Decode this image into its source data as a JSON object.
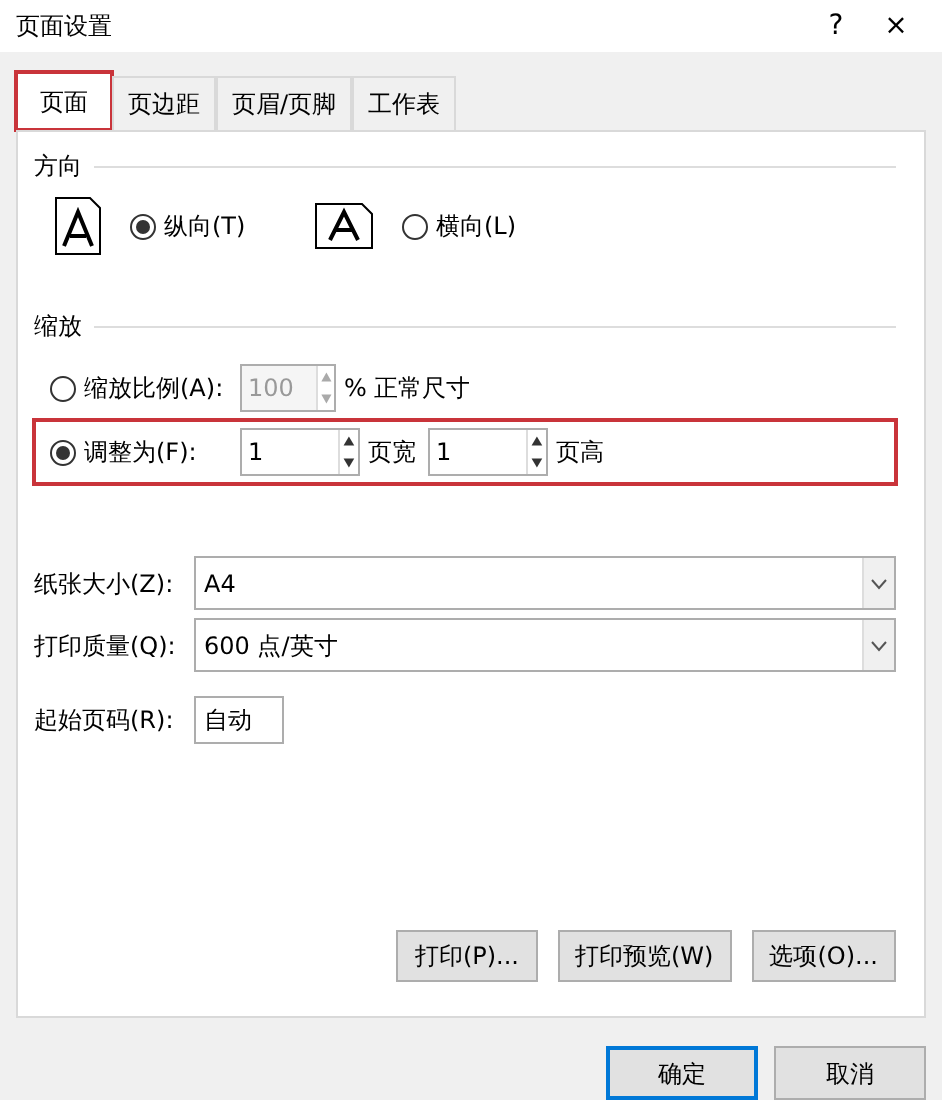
{
  "window": {
    "title": "页面设置",
    "help": "?",
    "close": "×"
  },
  "tabs": [
    {
      "label": "页面",
      "selected": true,
      "highlighted": true
    },
    {
      "label": "页边距",
      "selected": false,
      "highlighted": false
    },
    {
      "label": "页眉/页脚",
      "selected": false,
      "highlighted": false
    },
    {
      "label": "工作表",
      "selected": false,
      "highlighted": false
    }
  ],
  "orientation": {
    "title": "方向",
    "options": [
      {
        "label": "纵向(T)",
        "selected": true,
        "kind": "portrait"
      },
      {
        "label": "横向(L)",
        "selected": false,
        "kind": "landscape"
      }
    ]
  },
  "scaling": {
    "title": "缩放",
    "options": [
      {
        "label": "缩放比例(A):",
        "selected": false,
        "highlighted": false,
        "fields": [
          {
            "value": "100",
            "disabled": true,
            "suffix": "% 正常尺寸"
          }
        ]
      },
      {
        "label": "调整为(F):",
        "selected": true,
        "highlighted": true,
        "fields": [
          {
            "value": "1",
            "disabled": false,
            "suffix": "页宽"
          },
          {
            "value": "1",
            "disabled": false,
            "suffix": "页高"
          }
        ]
      }
    ]
  },
  "paper_size": {
    "label": "纸张大小(Z):",
    "value": "A4"
  },
  "print_quality": {
    "label": "打印质量(Q):",
    "value": "600 点/英寸"
  },
  "first_page_number": {
    "label": "起始页码(R):",
    "value": "自动"
  },
  "panel_buttons": [
    "打印(P)...",
    "打印预览(W)",
    "选项(O)..."
  ],
  "dialog_buttons": [
    {
      "label": "确定",
      "default": true
    },
    {
      "label": "取消",
      "default": false
    }
  ]
}
